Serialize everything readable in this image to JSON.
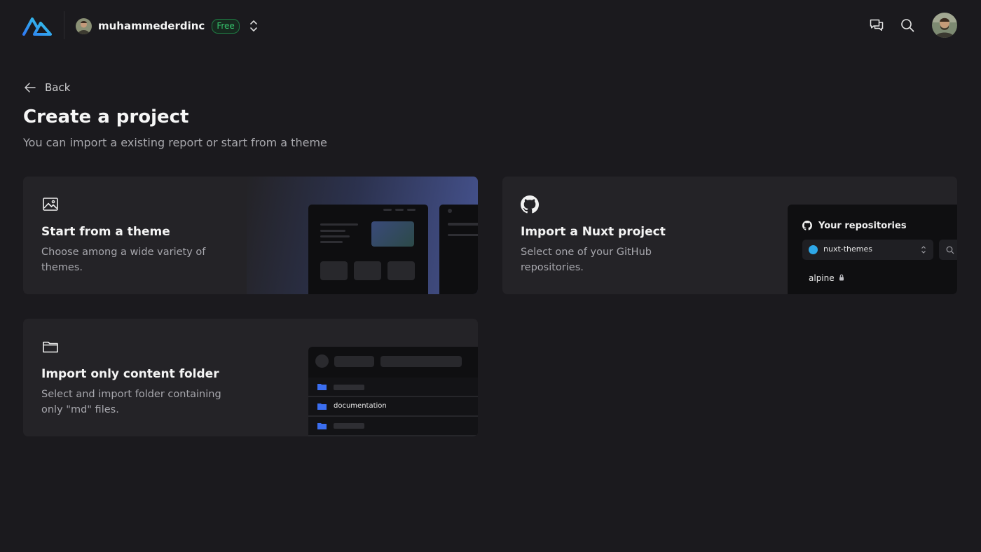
{
  "header": {
    "team_name": "muhammederdinc",
    "plan_badge": "Free"
  },
  "nav": {
    "back_label": "Back"
  },
  "page": {
    "title": "Create a project",
    "subtitle": "You can import a existing report or start from a theme"
  },
  "cards": [
    {
      "title": "Start from a theme",
      "description": "Choose among a wide variety of themes.",
      "icon": "image-icon"
    },
    {
      "title": "Import a Nuxt project",
      "description": "Select one of your GitHub repositories.",
      "icon": "github-icon",
      "preview": {
        "heading": "Your repositories",
        "selected_repo": "nuxt-themes",
        "repo_item": "alpine"
      }
    },
    {
      "title": "Import only content folder",
      "description": "Select and import folder containing only \"md\" files.",
      "icon": "folder-icon",
      "preview": {
        "folder_label": "documentation"
      }
    }
  ],
  "colors": {
    "background": "#1b1a1e",
    "card": "#242327",
    "badge_green": "#36c26c",
    "accent_blue": "#3b6ef0"
  }
}
